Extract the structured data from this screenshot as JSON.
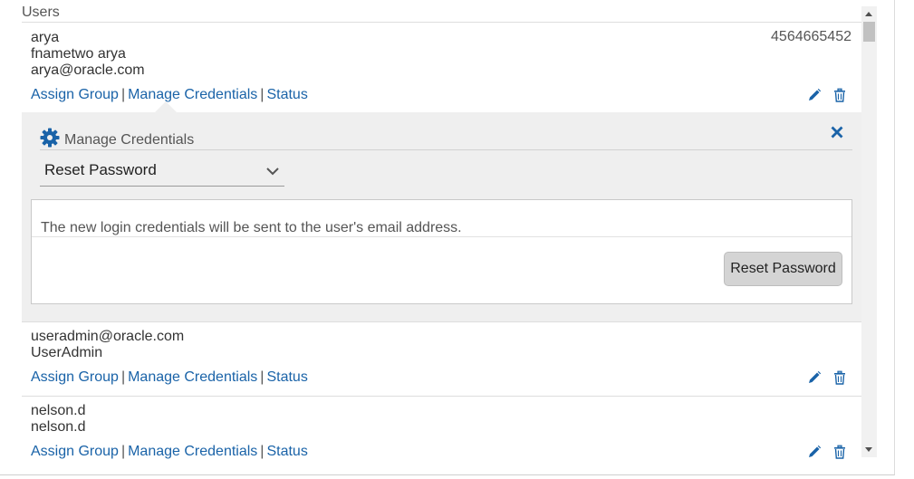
{
  "section": {
    "title": "Users"
  },
  "links": {
    "assign_group": "Assign Group",
    "separator": "|",
    "manage_credentials": "Manage Credentials",
    "status": "Status"
  },
  "users": [
    {
      "line1": "arya",
      "line2": "fnametwo arya",
      "line3": "arya@oracle.com",
      "phone": "4564665452"
    },
    {
      "line1": "useradmin@oracle.com",
      "line2": "UserAdmin"
    },
    {
      "line1": "nelson.d",
      "line2": "nelson.d"
    }
  ],
  "manage_credentials": {
    "title": "Manage Credentials",
    "action_select": {
      "selected": "Reset Password"
    },
    "message": "The new login credentials will be sent to the user's email address.",
    "submit_label": "Reset Password"
  },
  "colors": {
    "link": "#1a63a8",
    "icon": "#1a63a8",
    "panel_bg": "#efefef",
    "button_bg": "#d4d4d4"
  },
  "icons": {
    "edit": "pencil-icon",
    "delete": "trash-icon",
    "settings": "gear-icon",
    "close": "close-icon",
    "dropdown": "chevron-down-icon"
  }
}
